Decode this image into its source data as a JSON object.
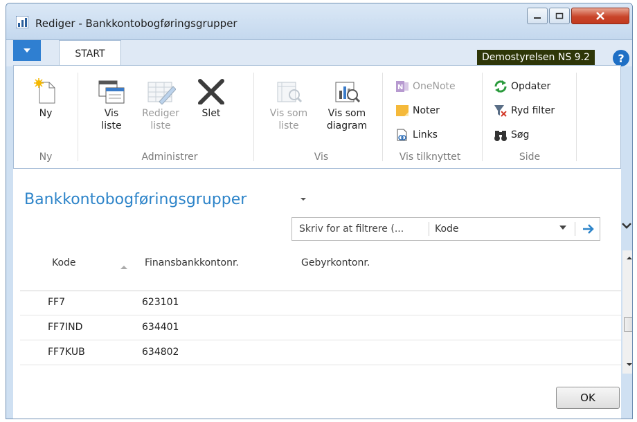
{
  "window": {
    "title": "Rediger - Bankkontobogføringsgrupper"
  },
  "ribbon_tabs": {
    "start": "START"
  },
  "company": "Demostyrelsen NS 9.2",
  "help": "?",
  "ribbon": {
    "ny": {
      "ny": "Ny",
      "group": "Ny"
    },
    "administrer": {
      "vis_liste_1": "Vis",
      "vis_liste_2": "liste",
      "rediger_1": "Rediger",
      "rediger_2": "liste",
      "slet": "Slet",
      "group": "Administrer"
    },
    "vis": {
      "vis_som_liste_1": "Vis som",
      "vis_som_liste_2": "liste",
      "vis_som_diagram_1": "Vis som",
      "vis_som_diagram_2": "diagram",
      "group": "Vis"
    },
    "vis_tilknyttet": {
      "onenote": "OneNote",
      "noter": "Noter",
      "links": "Links",
      "group": "Vis tilknyttet"
    },
    "side": {
      "opdater": "Opdater",
      "ryd_filter": "Ryd filter",
      "sog": "Søg",
      "group": "Side"
    }
  },
  "page": {
    "title": "Bankkontobogføringsgrupper"
  },
  "filter": {
    "placeholder": "Skriv for at filtrere (...",
    "field": "Kode"
  },
  "table": {
    "columns": [
      "Kode",
      "Finansbankkontonr.",
      "Gebyrkontonr."
    ],
    "rows": [
      {
        "kode": "FF7",
        "finans": "623101",
        "gebyr": ""
      },
      {
        "kode": "FF7IND",
        "finans": "634401",
        "gebyr": ""
      },
      {
        "kode": "FF7KUB",
        "finans": "634802",
        "gebyr": ""
      }
    ]
  },
  "ok_label": "OK",
  "colors": {
    "accent": "#2d84c9",
    "file_tab": "#2f7fd1",
    "company_bg": "#2e3608"
  }
}
